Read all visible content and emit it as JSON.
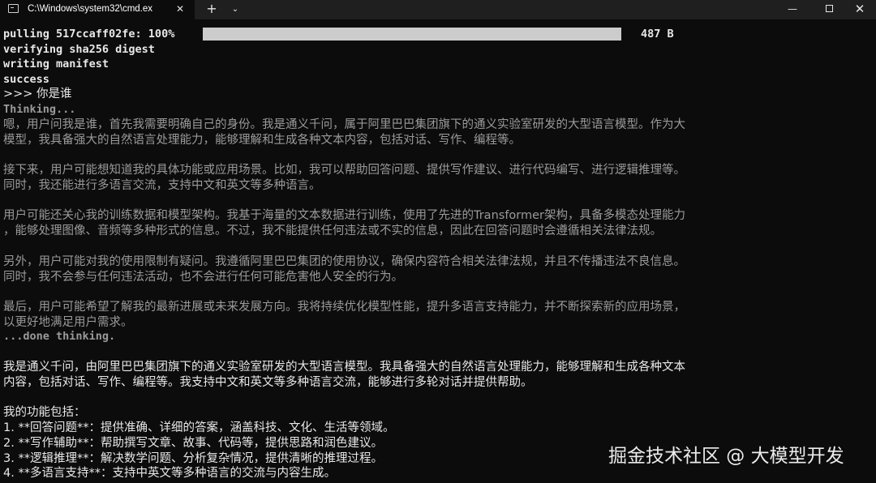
{
  "titlebar": {
    "tab_title": "C:\\Windows\\system32\\cmd.ex",
    "tab_close": "✕",
    "new_tab": "+",
    "dropdown": "⌄",
    "minimize": "—",
    "close": "✕"
  },
  "download": {
    "label": "pulling 517ccaff02fe: 100%",
    "progress": 1.0,
    "size": "487 B"
  },
  "lines": {
    "verify": "verifying sha256 digest",
    "manifest": "writing manifest",
    "success": "success",
    "prompt": ">>> 你是谁",
    "thinking": "Thinking...",
    "t1a": "嗯，用户问我是谁，首先我需要明确自己的身份。我是通义千问，属于阿里巴巴集团旗下的通义实验室研发的大型语言模型。作为大",
    "t1b": "模型，我具备强大的自然语言处理能力，能够理解和生成各种文本内容，包括对话、写作、编程等。",
    "t2a": "接下来，用户可能想知道我的具体功能或应用场景。比如，我可以帮助回答问题、提供写作建议、进行代码编写、进行逻辑推理等。",
    "t2b": "同时，我还能进行多语言交流，支持中文和英文等多种语言。",
    "t3a": "用户可能还关心我的训练数据和模型架构。我基于海量的文本数据进行训练，使用了先进的Transformer架构，具备多模态处理能力",
    "t3b": "，能够处理图像、音频等多种形式的信息。不过，我不能提供任何违法或不实的信息，因此在回答问题时会遵循相关法律法规。",
    "t4a": "另外，用户可能对我的使用限制有疑问。我遵循阿里巴巴集团的使用协议，确保内容符合相关法律法规，并且不传播违法不良信息。",
    "t4b": "同时，我不会参与任何违法活动，也不会进行任何可能危害他人安全的行为。",
    "t5a": "最后，用户可能希望了解我的最新进展或未来发展方向。我将持续优化模型性能，提升多语言支持能力，并不断探索新的应用场景，",
    "t5b": "以更好地满足用户需求。",
    "done": "...done thinking.",
    "a1a": "我是通义千问，由阿里巴巴集团旗下的通义实验室研发的大型语言模型。我具备强大的自然语言处理能力，能够理解和生成各种文本",
    "a1b": "内容，包括对话、写作、编程等。我支持中文和英文等多种语言交流，能够进行多轮对话并提供帮助。",
    "feat_title": "我的功能包括：",
    "f1": "1. **回答问题**：提供准确、详细的答案，涵盖科技、文化、生活等领域。",
    "f2": "2. **写作辅助**：帮助撰写文章、故事、代码等，提供思路和润色建议。",
    "f3": "3. **逻辑推理**：解决数学问题、分析复杂情况，提供清晰的推理过程。",
    "f4": "4. **多语言支持**：支持中英文等多种语言的交流与内容生成。"
  },
  "watermark": "掘金技术社区 @ 大模型开发",
  "colors": {
    "background": "#0c0c0c",
    "text": "#e8e8e8",
    "thinking_text": "#9a9a9a",
    "progress_fill": "#cccccc"
  }
}
